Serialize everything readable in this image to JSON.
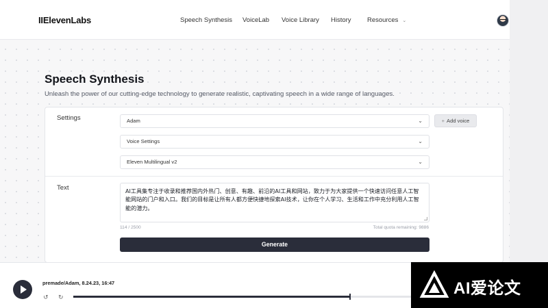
{
  "header": {
    "logo": "IIElevenLabs",
    "nav": [
      {
        "label": "Speech Synthesis"
      },
      {
        "label": "VoiceLab"
      },
      {
        "label": "Voice Library"
      },
      {
        "label": "History"
      },
      {
        "label": "Resources"
      }
    ]
  },
  "page": {
    "title": "Speech Synthesis",
    "subtitle": "Unleash the power of our cutting-edge technology to generate realistic, captivating speech in a wide range of languages."
  },
  "settings": {
    "label": "Settings",
    "voice": "Adam",
    "add_voice": "Add voice",
    "voice_settings": "Voice Settings",
    "model": "Eleven Multilingual v2"
  },
  "text_section": {
    "label": "Text",
    "content": "AI工具集专注于收录和推荐国内外热门、创意、有趣、前沿的AI工具和网站，致力于为大家提供一个快速访问任意人工智能网站的门户和入口。我们的目标是让所有人都方便快捷地探索AI技术，让你在个人学习、生活和工作中充分利用人工智能的潜力。",
    "char_count": "114 / 2500",
    "quota": "Total quota remaining: 9886",
    "generate": "Generate"
  },
  "player": {
    "track": "premade/Adam, 8.24.23, 16:47",
    "progress": 0.82
  },
  "watermark": {
    "text": "AI爱论文"
  },
  "icons": {
    "resources_chevron": "chevron-down-icon",
    "select_chevron": "chevron-down-icon",
    "add": "plus-icon",
    "play": "play-icon",
    "rewind": "rewind-icon",
    "forward": "forward-icon"
  }
}
